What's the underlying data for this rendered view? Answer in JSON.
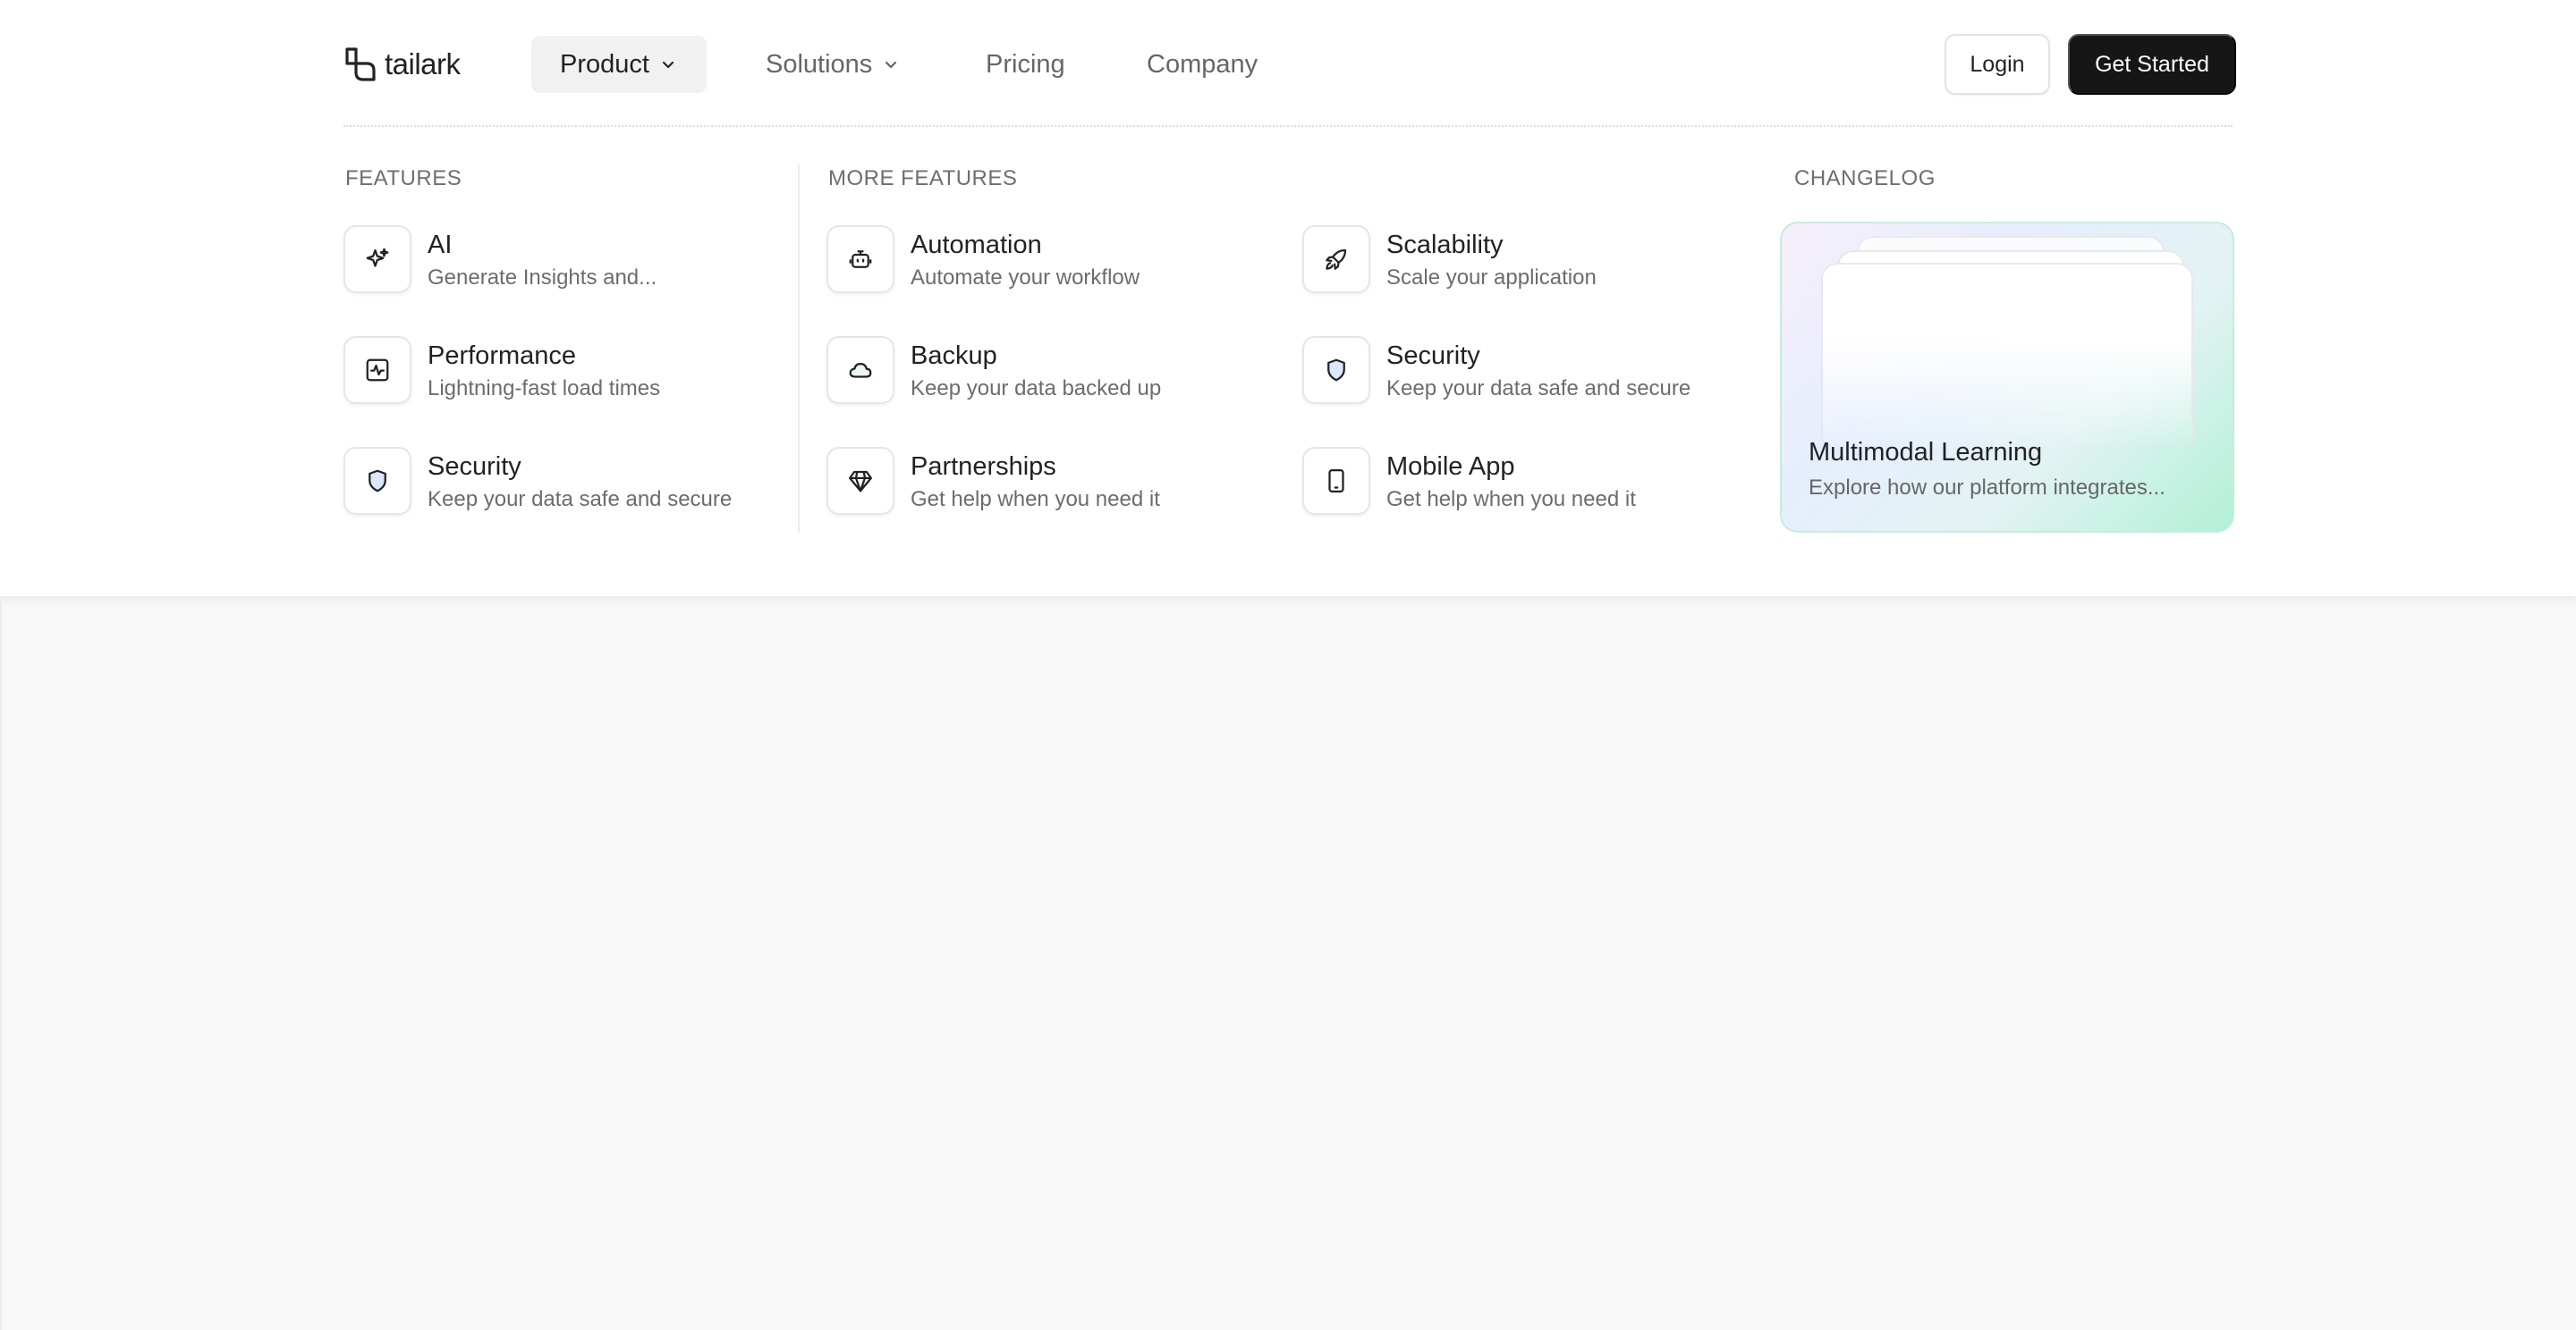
{
  "brand": {
    "name": "tailark"
  },
  "nav": {
    "items": [
      {
        "label": "Product",
        "active": true,
        "has_dropdown": true
      },
      {
        "label": "Solutions",
        "active": false,
        "has_dropdown": true
      },
      {
        "label": "Pricing",
        "active": false,
        "has_dropdown": false
      },
      {
        "label": "Company",
        "active": false,
        "has_dropdown": false
      }
    ]
  },
  "actions": {
    "login": "Login",
    "get_started": "Get Started"
  },
  "menu": {
    "features": {
      "heading": "FEATURES",
      "items": [
        {
          "title": "AI",
          "desc": "Generate Insights and...",
          "icon": "sparkles-icon"
        },
        {
          "title": "Performance",
          "desc": "Lightning-fast load times",
          "icon": "activity-icon"
        },
        {
          "title": "Security",
          "desc": "Keep your data safe and secure",
          "icon": "shield-icon"
        }
      ]
    },
    "more_features": {
      "heading": "MORE FEATURES",
      "col1": [
        {
          "title": "Automation",
          "desc": "Automate your workflow",
          "icon": "bot-icon"
        },
        {
          "title": "Backup",
          "desc": "Keep your data backed up",
          "icon": "cloud-icon"
        },
        {
          "title": "Partnerships",
          "desc": "Get help when you need it",
          "icon": "gem-icon"
        }
      ],
      "col2": [
        {
          "title": "Scalability",
          "desc": "Scale your application",
          "icon": "rocket-icon"
        },
        {
          "title": "Security",
          "desc": "Keep your data safe and secure",
          "icon": "shield-icon"
        },
        {
          "title": "Mobile App",
          "desc": "Get help when you need it",
          "icon": "smartphone-icon"
        }
      ]
    },
    "changelog": {
      "heading": "CHANGELOG",
      "card_title": "Multimodal Learning",
      "card_desc": "Explore how our platform integrates..."
    }
  },
  "colors": {
    "primary_button": "#161616",
    "page_background": "#f8f8f8",
    "card_gradient_end": "#b2f0d6"
  }
}
